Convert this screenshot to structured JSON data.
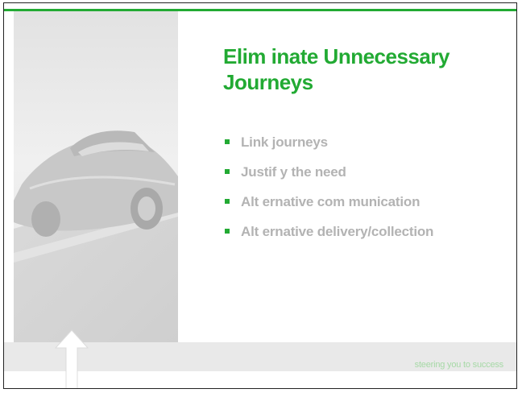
{
  "slide": {
    "title_line1": "Elim inate Unnecessary",
    "title_line2": "Journeys",
    "bullets": [
      "Link journeys",
      "Justif y the need",
      "Alt ernative com munication",
      "Alt ernative delivery/collection"
    ],
    "tagline": "steering you to success"
  },
  "colors": {
    "accent_green": "#22aa33",
    "bullet_text": "#b3b3b3",
    "footer_band": "#e9e9e9",
    "tagline": "#a6d9a6"
  },
  "icons": {
    "bullet": "square-bullet-icon",
    "arrow": "up-arrow-icon",
    "photo": "car-photo"
  }
}
